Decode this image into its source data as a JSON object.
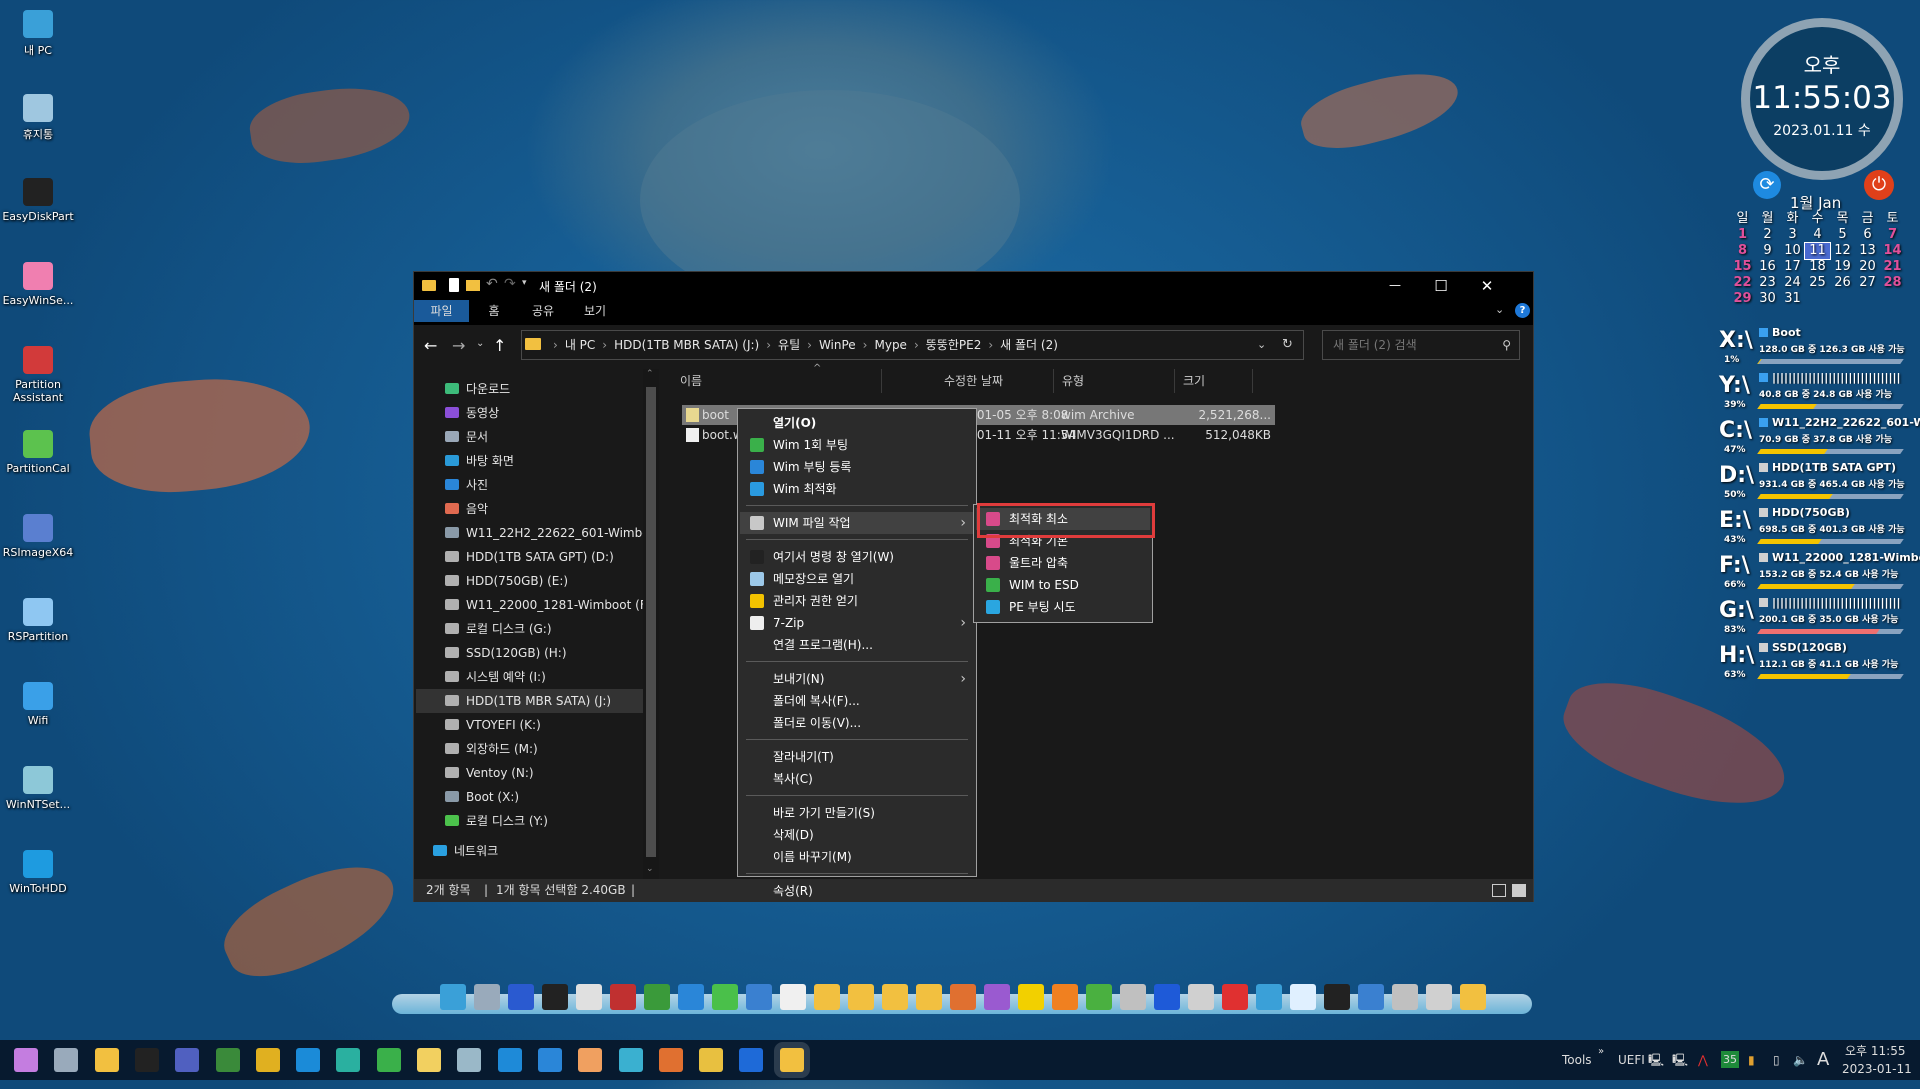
{
  "desktop_icons": [
    {
      "label": "내 PC",
      "color": "#3aa0d8"
    },
    {
      "label": "휴지통",
      "color": "#9fc7e0"
    },
    {
      "label": "EasyDiskPart",
      "color": "#222222"
    },
    {
      "label": "EasyWinSe...",
      "color": "#f07fb0"
    },
    {
      "label": "Partition Assistant",
      "color": "#d23a3a"
    },
    {
      "label": "PartitionCal",
      "color": "#5cc24e"
    },
    {
      "label": "RSImageX64",
      "color": "#5a7fd0"
    },
    {
      "label": "RSPartition",
      "color": "#8fc7f2"
    },
    {
      "label": "Wifi",
      "color": "#3aa0e8"
    },
    {
      "label": "WinNTSet...",
      "color": "#8dc8d8"
    },
    {
      "label": "WinToHDD",
      "color": "#1e9be0"
    }
  ],
  "window": {
    "title": "새 폴더 (2)",
    "ribbon_tabs": [
      "파일",
      "홈",
      "공유",
      "보기"
    ],
    "accent": "#1a5a9a",
    "breadcrumb": [
      "내 PC",
      "HDD(1TB MBR SATA) (J:)",
      "유틸",
      "WinPe",
      "Mype",
      "뚱뚱한PE2",
      "새 폴더 (2)"
    ],
    "search_placeholder": "새 폴더 (2) 검색",
    "nav_items": [
      {
        "label": "다운로드",
        "icon": "download-icon",
        "color": "#3dbb7a"
      },
      {
        "label": "동영상",
        "icon": "video-icon",
        "color": "#8b4fd8"
      },
      {
        "label": "문서",
        "icon": "document-icon",
        "color": "#9aa8b8"
      },
      {
        "label": "바탕 화면",
        "icon": "desktop-icon",
        "color": "#2a9ad8"
      },
      {
        "label": "사진",
        "icon": "pictures-icon",
        "color": "#2a86d8"
      },
      {
        "label": "음악",
        "icon": "music-icon",
        "color": "#e06a50"
      },
      {
        "label": "W11_22H2_22622_601-Wimboot (C:)",
        "icon": "windows-drive-icon",
        "color": "#8a9aa8"
      },
      {
        "label": "HDD(1TB SATA GPT) (D:)",
        "icon": "drive-icon",
        "color": "#b0b0b0"
      },
      {
        "label": "HDD(750GB) (E:)",
        "icon": "drive-icon",
        "color": "#b0b0b0"
      },
      {
        "label": "W11_22000_1281-Wimboot (F:)",
        "icon": "drive-icon",
        "color": "#b0b0b0"
      },
      {
        "label": "로컬 디스크 (G:)",
        "icon": "drive-icon",
        "color": "#b0b0b0"
      },
      {
        "label": "SSD(120GB) (H:)",
        "icon": "drive-icon",
        "color": "#b0b0b0"
      },
      {
        "label": "시스템 예약 (I:)",
        "icon": "drive-icon",
        "color": "#b0b0b0"
      },
      {
        "label": "HDD(1TB MBR SATA) (J:)",
        "icon": "drive-icon",
        "color": "#b0b0b0",
        "selected": true
      },
      {
        "label": "VTOYEFI (K:)",
        "icon": "drive-icon",
        "color": "#b0b0b0"
      },
      {
        "label": "외장하드 (M:)",
        "icon": "drive-icon",
        "color": "#b0b0b0"
      },
      {
        "label": "Ventoy (N:)",
        "icon": "drive-icon",
        "color": "#b0b0b0"
      },
      {
        "label": "Boot (X:)",
        "icon": "windows-drive-icon",
        "color": "#8a9aa8"
      },
      {
        "label": "로컬 디스크 (Y:)",
        "icon": "drive-icon",
        "color": "#4cc24c"
      },
      {
        "label": "네트워크",
        "icon": "network-icon",
        "color": "#2aa0e0"
      }
    ],
    "columns": [
      "이름",
      "수정한 날짜",
      "유형",
      "크기"
    ],
    "files": [
      {
        "name": "boot",
        "date": "2023-01-05 오후 8:08",
        "type": "wim Archive",
        "size": "2,521,268...",
        "selected": true
      },
      {
        "name": "boot.wim",
        "date": "2023-01-11 오후 11:54",
        "type": "WIMV3GQI1DRD ...",
        "size": "512,048KB"
      }
    ],
    "status": {
      "count": "2개 항목",
      "selection": "1개 항목 선택함 2.40GB"
    }
  },
  "context_menu": {
    "items": [
      {
        "label": "열기(O)",
        "bold": true
      },
      {
        "label": "Wim 1회 부팅",
        "icon": "boot-once-icon",
        "color": "#3ab04a"
      },
      {
        "label": "Wim 부팅 등록",
        "icon": "boot-register-icon",
        "color": "#2a86d8"
      },
      {
        "label": "Wim 최적화",
        "icon": "optimize-icon",
        "color": "#2a9ae0"
      },
      {
        "sep": true
      },
      {
        "label": "WIM 파일 작업",
        "icon": "disc-icon",
        "color": "#c8c8c8",
        "submenu": true,
        "hover": true
      },
      {
        "sep": true
      },
      {
        "label": "여기서 명령 창 열기(W)",
        "icon": "cmd-icon",
        "color": "#222222"
      },
      {
        "label": "메모장으로 열기",
        "icon": "notepad-icon",
        "color": "#9cc8e8"
      },
      {
        "label": "관리자 권한 얻기",
        "icon": "shield-icon",
        "color": "#f2c200"
      },
      {
        "label": "7-Zip",
        "icon": "7zip-icon",
        "color": "#eeeeee",
        "submenu": true
      },
      {
        "label": "연결 프로그램(H)..."
      },
      {
        "sep": true
      },
      {
        "label": "보내기(N)",
        "submenu": true
      },
      {
        "label": "폴더에 복사(F)..."
      },
      {
        "label": "폴더로 이동(V)..."
      },
      {
        "sep": true
      },
      {
        "label": "잘라내기(T)"
      },
      {
        "label": "복사(C)"
      },
      {
        "sep": true
      },
      {
        "label": "바로 가기 만들기(S)"
      },
      {
        "label": "삭제(D)"
      },
      {
        "label": "이름 바꾸기(M)"
      },
      {
        "sep": true
      },
      {
        "label": "속성(R)"
      }
    ],
    "submenu": [
      {
        "label": "최적화 최소",
        "icon": "wim-compress-icon",
        "color": "#d84a8a",
        "hover": true
      },
      {
        "label": "최적화 기본",
        "icon": "wim-compress-icon",
        "color": "#d84a8a"
      },
      {
        "label": "울트라 압축",
        "icon": "wim-compress-icon",
        "color": "#d84a8a"
      },
      {
        "label": "WIM to ESD",
        "icon": "wim-to-esd-icon",
        "color": "#3ab04a"
      },
      {
        "label": "PE 부팅 시도",
        "icon": "pe-boot-icon",
        "color": "#2aa6e0"
      }
    ],
    "highlight_color": "#e03c3c"
  },
  "clock_widget": {
    "ampm": "오후",
    "time": "11:55:03",
    "date": "2023.01.11 수",
    "month": "1월 Jan",
    "weekdays": [
      "일",
      "월",
      "화",
      "수",
      "목",
      "금",
      "토"
    ],
    "weeks": [
      [
        "1",
        "2",
        "3",
        "4",
        "5",
        "6",
        "7"
      ],
      [
        "8",
        "9",
        "10",
        "11",
        "12",
        "13",
        "14"
      ],
      [
        "15",
        "16",
        "17",
        "18",
        "19",
        "20",
        "21"
      ],
      [
        "22",
        "23",
        "24",
        "25",
        "26",
        "27",
        "28"
      ],
      [
        "29",
        "30",
        "31",
        "",
        "",
        "",
        ""
      ]
    ],
    "today": "11"
  },
  "drives": [
    {
      "letter": "X:\\",
      "percent": "1%",
      "used": 0.01,
      "name": "Boot",
      "free": "128.0 GB 중 126.3 GB 사용 가능",
      "win": true
    },
    {
      "letter": "Y:\\",
      "percent": "39%",
      "used": 0.39,
      "name": "||||||||||||||||||||||||||||||||",
      "free": "40.8 GB 중   24.8 GB 사용 가능",
      "win": true
    },
    {
      "letter": "C:\\",
      "percent": "47%",
      "used": 0.47,
      "name": "W11_22H2_22622_601-Wimboot",
      "free": "70.9 GB 중   37.8 GB 사용 가능",
      "win": true
    },
    {
      "letter": "D:\\",
      "percent": "50%",
      "used": 0.5,
      "name": "HDD(1TB SATA GPT)",
      "free": "931.4 GB 중 465.4 GB 사용 가능"
    },
    {
      "letter": "E:\\",
      "percent": "43%",
      "used": 0.43,
      "name": "HDD(750GB)",
      "free": "698.5 GB 중 401.3 GB 사용 가능"
    },
    {
      "letter": "F:\\",
      "percent": "66%",
      "used": 0.66,
      "name": "W11_22000_1281-Wimboot",
      "free": "153.2 GB 중 52.4 GB 사용 가능"
    },
    {
      "letter": "G:\\",
      "percent": "83%",
      "used": 0.83,
      "name": "||||||||||||||||||||||||||||||||",
      "free": "200.1 GB 중 35.0 GB 사용 가능",
      "warn": true
    },
    {
      "letter": "H:\\",
      "percent": "63%",
      "used": 0.63,
      "name": "SSD(120GB)",
      "free": "112.1 GB 중 41.1 GB 사용 가능"
    }
  ],
  "taskbar": {
    "apps": [
      "start",
      "search",
      "file-explorer",
      "cmd",
      "save",
      "network-card",
      "chrome",
      "edge",
      "monitor",
      "app-install",
      "folder-up",
      "eraser",
      "window",
      "photos",
      "drop",
      "net-restore",
      "net-transfer",
      "rufus",
      "power",
      "folder"
    ],
    "app_colors": [
      "#c47de0",
      "#9ab",
      "#f2c040",
      "#222",
      "#5060c0",
      "#3a8a3a",
      "#e0b020",
      "#1b8bd8",
      "#2ab0a0",
      "#3ab04a",
      "#f2d060",
      "#9ab8c8",
      "#1e8ad8",
      "#2a86d8",
      "#f0a060",
      "#3ab0d0",
      "#e07030",
      "#e8c040",
      "#1e6ad8",
      "#f2c040"
    ],
    "tray": {
      "tools": "Tools",
      "uefi": "UEFI",
      "badge": "35",
      "ime": "A",
      "time": "오후 11:55",
      "date": "2023-01-11"
    }
  },
  "dock_colors": [
    "#3aa0d8",
    "#9ab",
    "#2a5ad0",
    "#222",
    "#e0e0e0",
    "#c03030",
    "#3a9a3a",
    "#2a86d8",
    "#4ac04a",
    "#3a80d0",
    "#f0f0f0",
    "#f2c040",
    "#f2c040",
    "#f2c040",
    "#f2c040",
    "#e07030",
    "#9a5ad0",
    "#f2d000",
    "#f08020",
    "#4ab040",
    "#c0c0c0",
    "#1e5ad8",
    "#d0d0d0",
    "#e03030",
    "#3aa0d8",
    "#e0f0ff",
    "#222",
    "#3a80d0",
    "#c0c0c0",
    "#d0d0d0",
    "#f2c040"
  ]
}
